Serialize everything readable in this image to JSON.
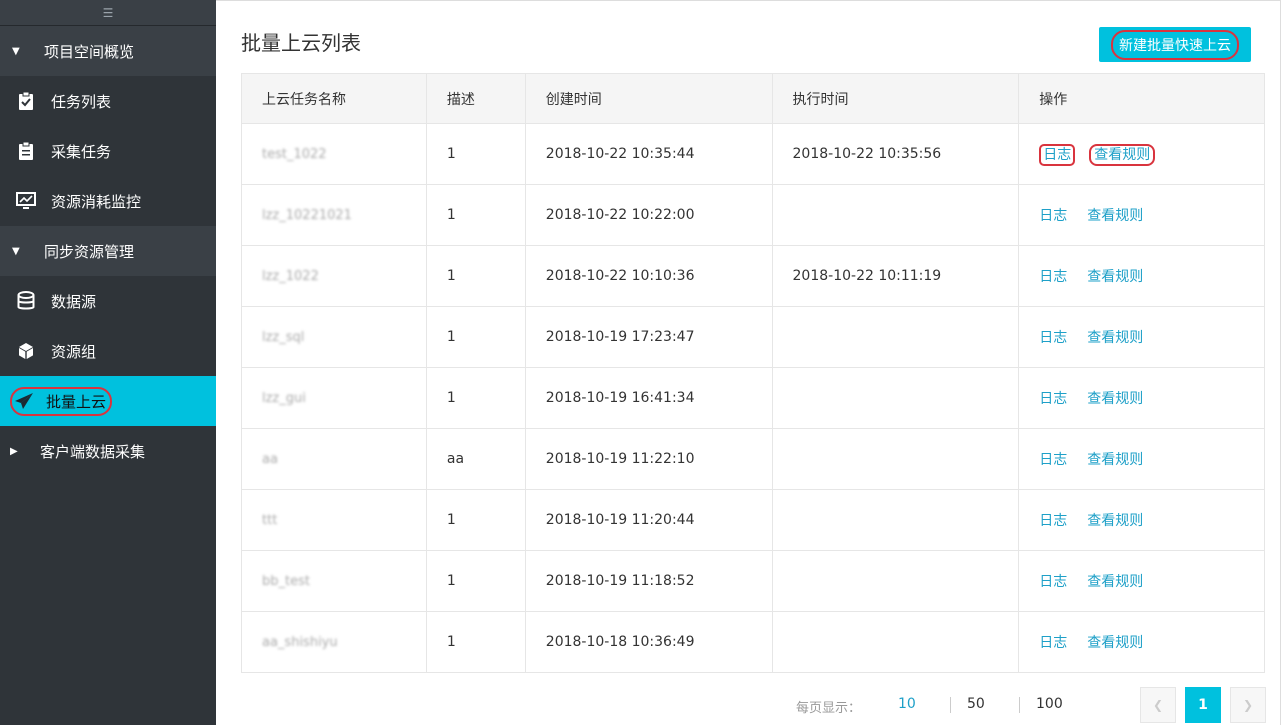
{
  "sidebar": {
    "collapse_icon": "hamburger-icon",
    "groups": [
      {
        "label": "项目空间概览"
      },
      {
        "label": "同步资源管理"
      },
      {
        "label": "客户端数据采集"
      }
    ],
    "items": [
      {
        "label": "任务列表",
        "icon": "clipboard-check-icon"
      },
      {
        "label": "采集任务",
        "icon": "clipboard-icon"
      },
      {
        "label": "资源消耗监控",
        "icon": "monitor-chart-icon"
      },
      {
        "label": "数据源",
        "icon": "database-icon"
      },
      {
        "label": "资源组",
        "icon": "cube-icon"
      },
      {
        "label": "批量上云",
        "icon": "paper-plane-icon"
      }
    ]
  },
  "main": {
    "title": "批量上云列表",
    "create_button": "新建批量快速上云",
    "columns": [
      "上云任务名称",
      "描述",
      "创建时间",
      "执行时间",
      "操作"
    ],
    "actions": {
      "log": "日志",
      "view_rules": "查看规则"
    },
    "rows": [
      {
        "name": "test_1022",
        "desc": "1",
        "created": "2018-10-22 10:35:44",
        "executed": "2018-10-22 10:35:56"
      },
      {
        "name": "lzz_10221021",
        "desc": "1",
        "created": "2018-10-22 10:22:00",
        "executed": ""
      },
      {
        "name": "lzz_1022",
        "desc": "1",
        "created": "2018-10-22 10:10:36",
        "executed": "2018-10-22 10:11:19"
      },
      {
        "name": "lzz_sql",
        "desc": "1",
        "created": "2018-10-19 17:23:47",
        "executed": ""
      },
      {
        "name": "lzz_gui",
        "desc": "1",
        "created": "2018-10-19 16:41:34",
        "executed": ""
      },
      {
        "name": "aa",
        "desc": "aa",
        "created": "2018-10-19 11:22:10",
        "executed": ""
      },
      {
        "name": "ttt",
        "desc": "1",
        "created": "2018-10-19 11:20:44",
        "executed": ""
      },
      {
        "name": "bb_test",
        "desc": "1",
        "created": "2018-10-19 11:18:52",
        "executed": ""
      },
      {
        "name": "aa_shishiyu",
        "desc": "1",
        "created": "2018-10-18 10:36:49",
        "executed": ""
      }
    ],
    "pager": {
      "page_size_label": "每页显示：",
      "sizes": [
        "10",
        "50",
        "100"
      ],
      "current_page": "1",
      "prev_icon": "chevron-left-icon",
      "next_icon": "chevron-right-icon"
    }
  },
  "colors": {
    "accent": "#00c1de",
    "sidebar": "#2f3439",
    "link": "#1ea0c8",
    "highlight": "#d9343e"
  }
}
